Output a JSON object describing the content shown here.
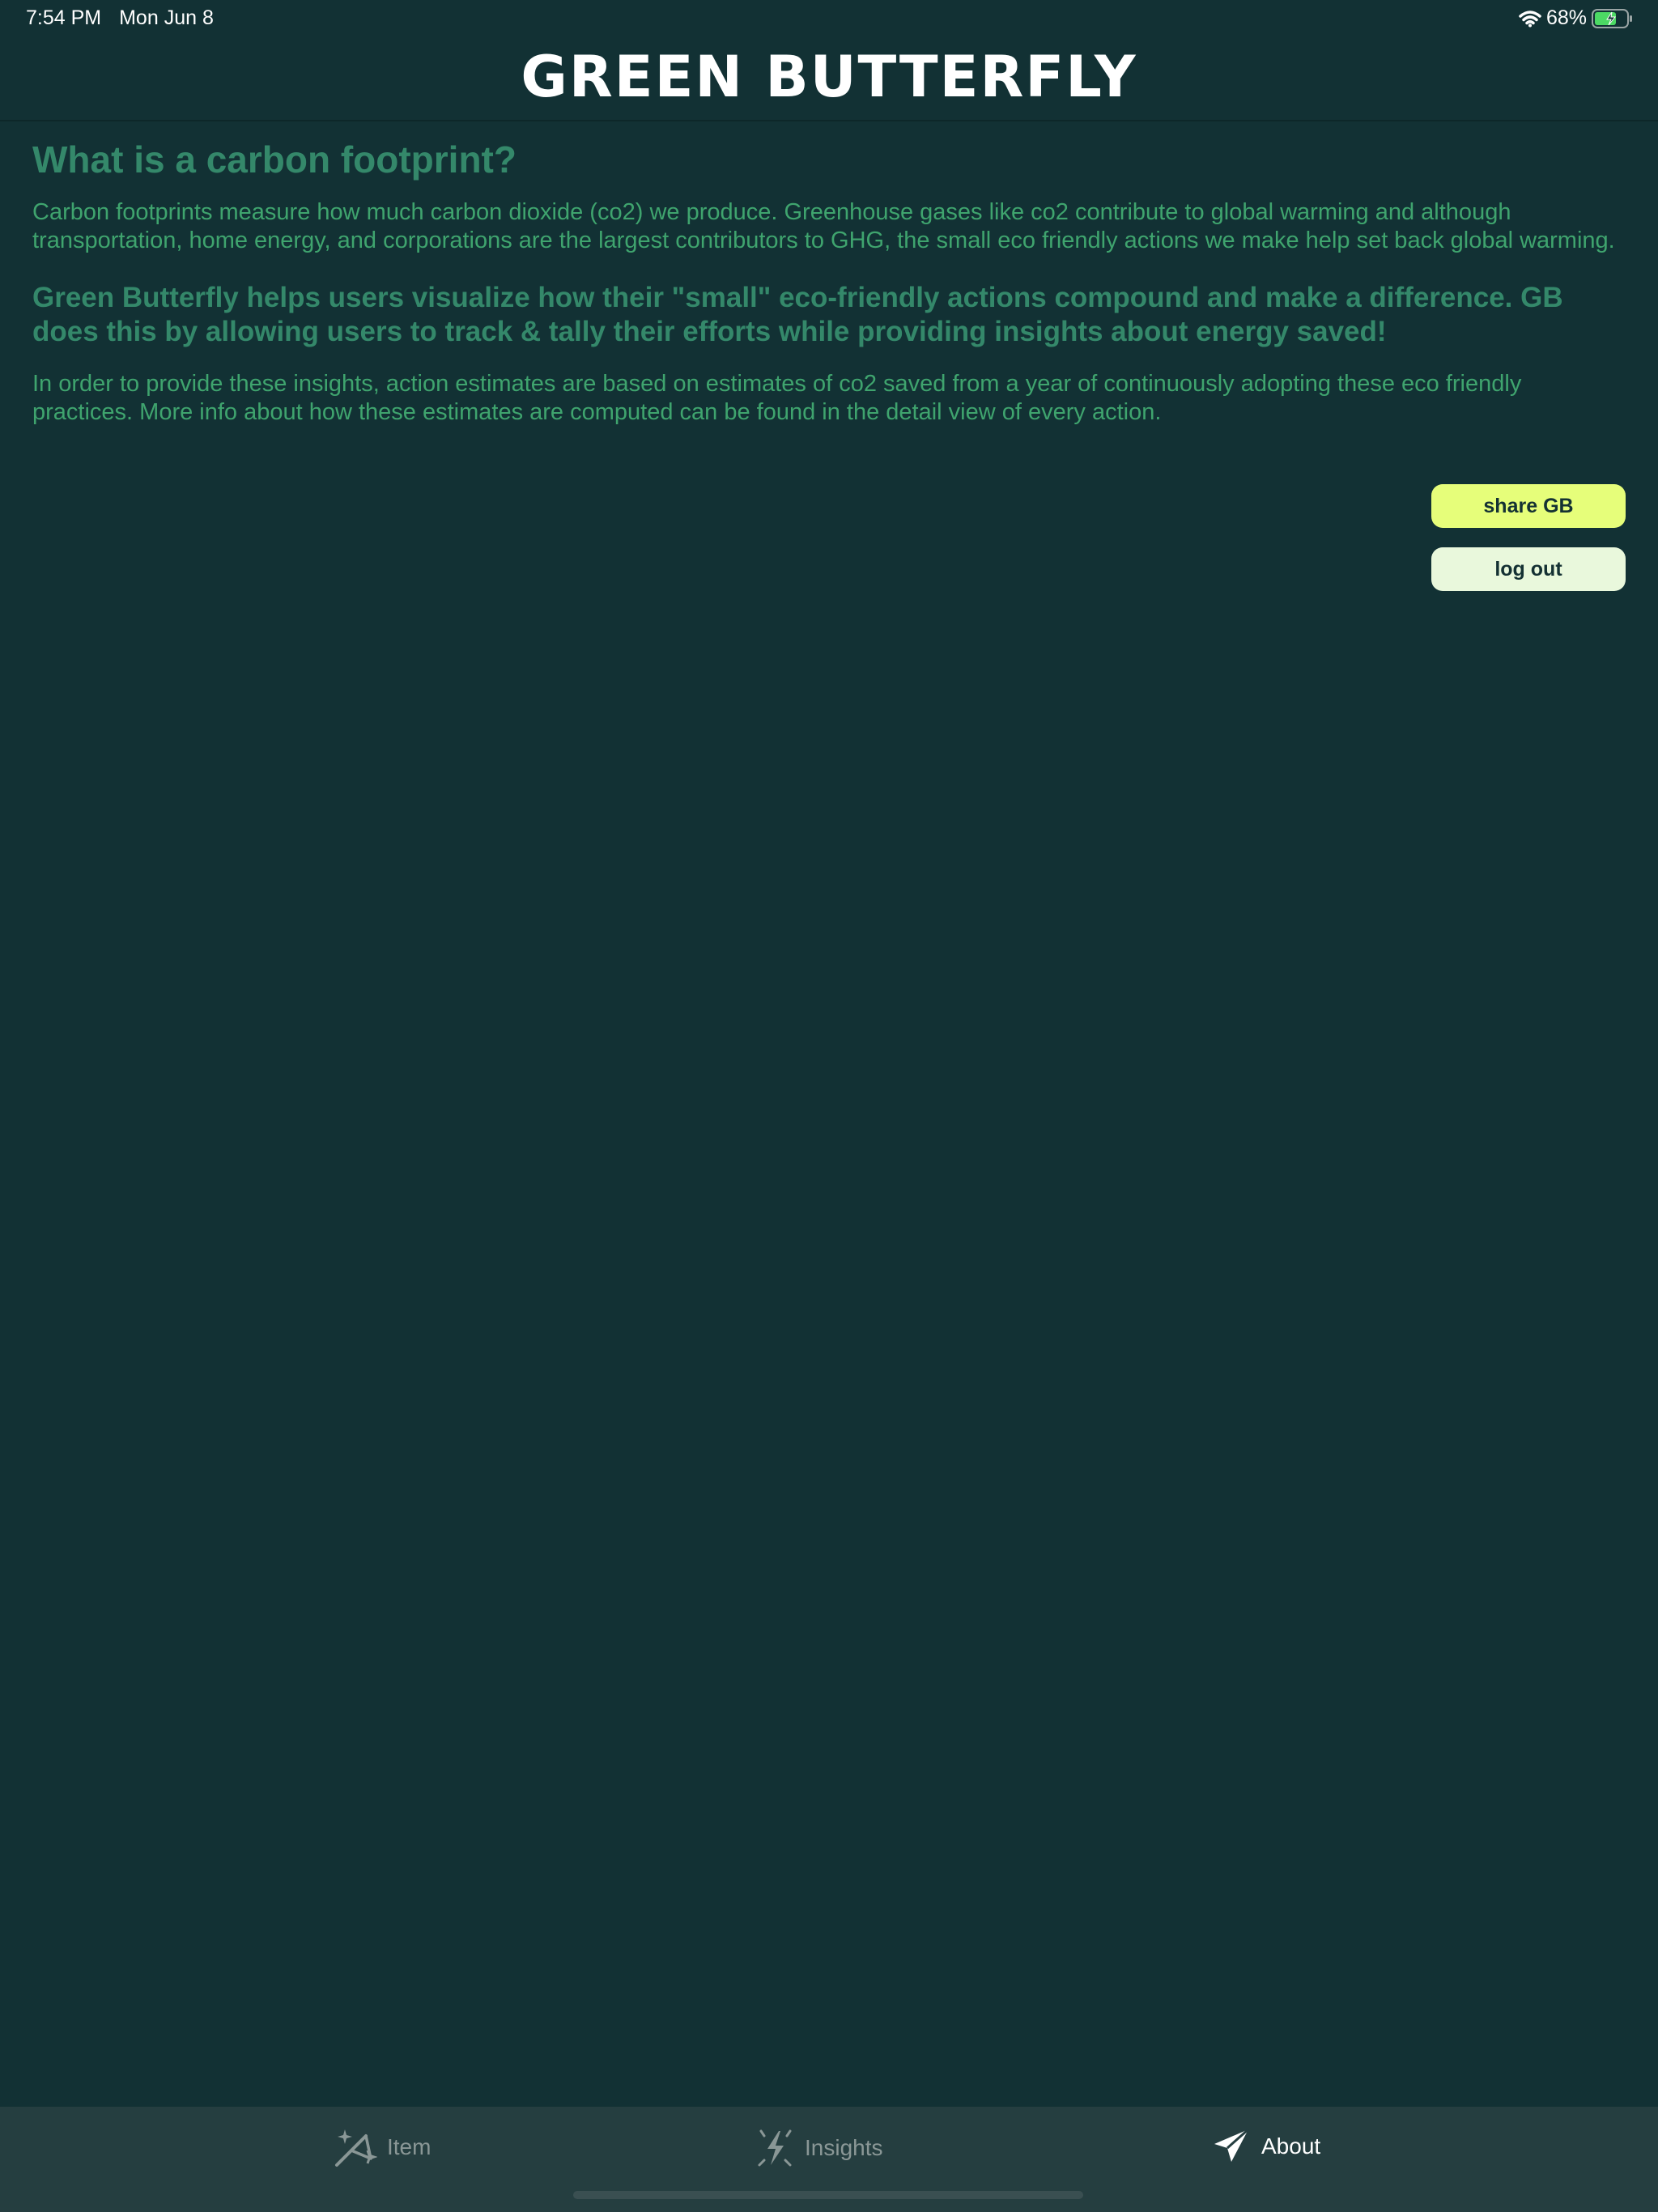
{
  "status_bar": {
    "time": "7:54 PM",
    "date": "Mon Jun 8",
    "battery": "68%",
    "battery_level": 0.68
  },
  "header": {
    "title": "Green Butterfly"
  },
  "content": {
    "heading": "What is a carbon footprint?",
    "paragraph1": "Carbon footprints measure how much carbon dioxide (co2) we produce. Greenhouse gases like co2 contribute to global warming and although transportation, home energy, and corporations are the largest contributors to GHG, the small eco friendly actions we make help set back global warming.",
    "emphasis": "Green Butterfly helps users visualize how their \"small\" eco-friendly actions compound and make a difference. GB does this by allowing users to track & tally their efforts while providing insights about energy saved!",
    "paragraph2": "In order to provide these insights, action estimates are based on estimates of co2 saved from a year of continuously adopting these eco friendly practices. More info about how these estimates are computed can be found in the detail view of every action."
  },
  "actions": {
    "share_label": "share GB",
    "logout_label": "log out"
  },
  "tabs": [
    {
      "label": "Item",
      "icon": "wand-sparkle-icon",
      "active": false
    },
    {
      "label": "Insights",
      "icon": "bolt-icon",
      "active": false
    },
    {
      "label": "About",
      "icon": "paper-plane-icon",
      "active": true
    }
  ],
  "colors": {
    "background": "#123134",
    "heading": "#34886a",
    "body_text": "#3fa46e",
    "share_button": "#e6fe7a",
    "logout_button": "#e9f8dc",
    "tab_bar": "#253e40"
  }
}
